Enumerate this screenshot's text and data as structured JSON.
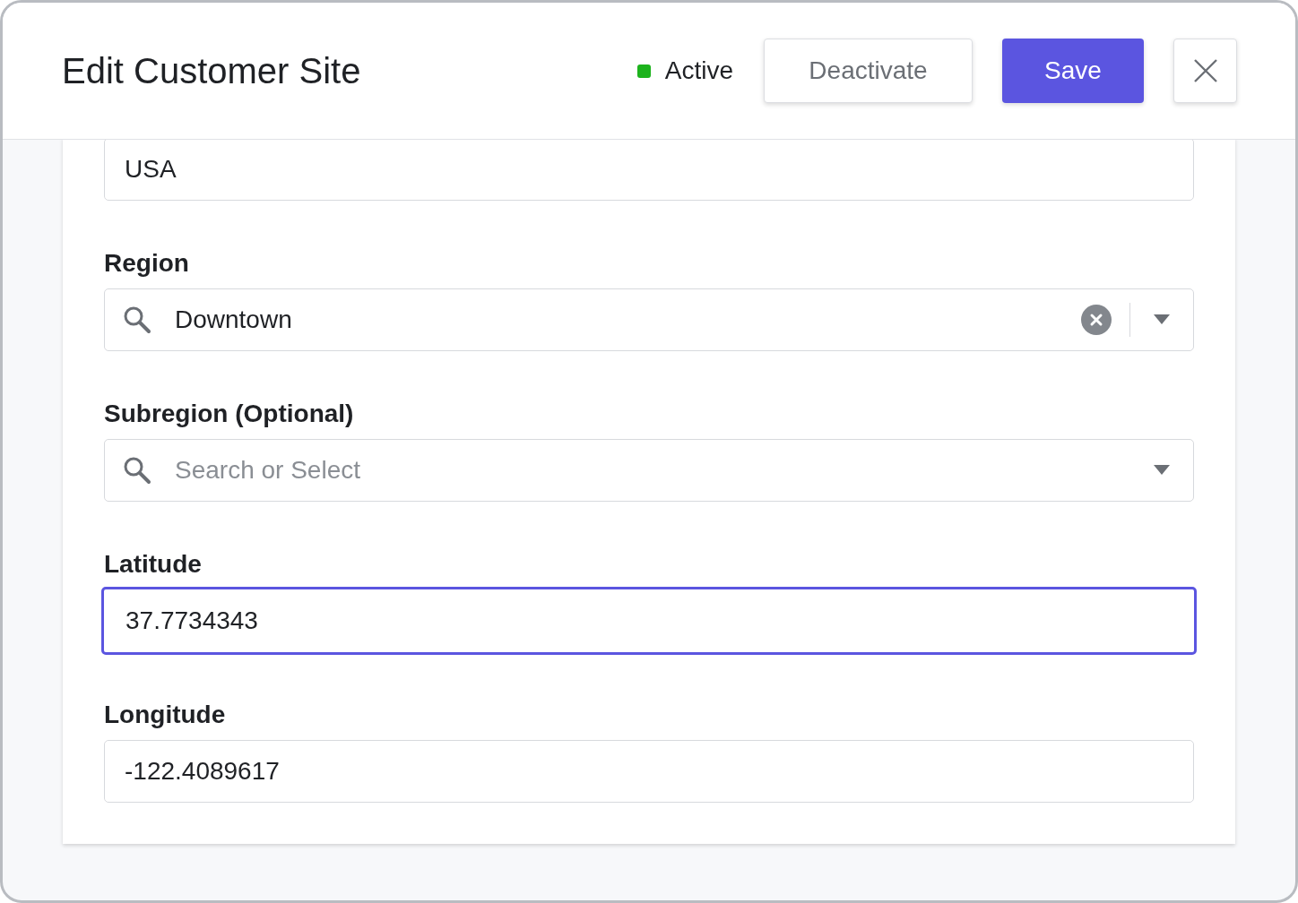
{
  "header": {
    "title": "Edit Customer Site",
    "status": {
      "label": "Active",
      "color": "#1db31d"
    },
    "buttons": [
      {
        "label": "Deactivate",
        "kind": "secondary"
      },
      {
        "label": "Save",
        "kind": "primary"
      }
    ]
  },
  "fields": [
    {
      "kind": "text",
      "value": "USA",
      "focused": false
    },
    {
      "kind": "select",
      "label": "Region",
      "value": "Downtown"
    },
    {
      "kind": "select",
      "label": "Subregion (Optional)",
      "placeholder": "Search or Select"
    },
    {
      "kind": "text",
      "label": "Latitude",
      "value": "37.7734343",
      "focused": true
    },
    {
      "kind": "text",
      "label": "Longitude",
      "value": "-122.4089617",
      "focused": false
    }
  ]
}
